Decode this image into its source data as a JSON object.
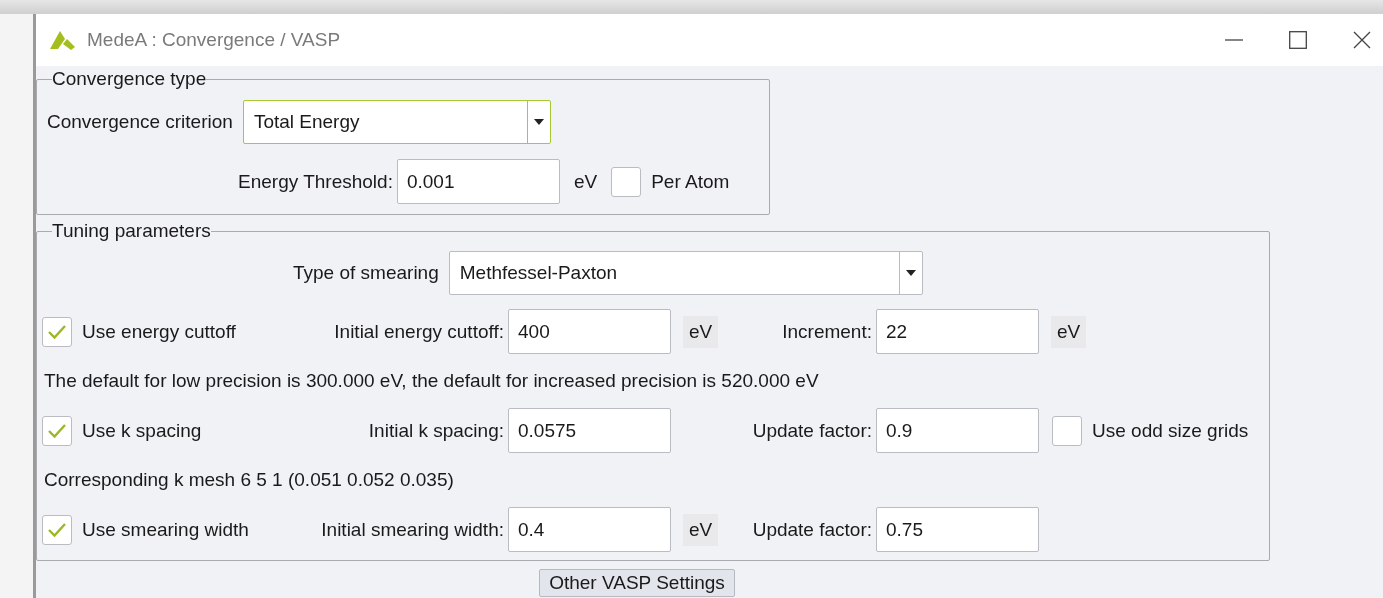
{
  "window": {
    "title": "MedeA : Convergence / VASP"
  },
  "convergence_type": {
    "title": "Convergence type",
    "criterion": {
      "label": "Convergence criterion",
      "value": "Total Energy",
      "focused": true
    },
    "threshold": {
      "label": "Energy Threshold:",
      "value": "0.001",
      "unit": "eV"
    },
    "per_atom": {
      "label": "Per Atom",
      "checked": false
    }
  },
  "tuning": {
    "title": "Tuning parameters",
    "smearing_type": {
      "label": "Type of smearing",
      "value": "Methfessel-Paxton",
      "focused": false
    },
    "rows": [
      {
        "kind": "params",
        "toggle": {
          "label": "Use energy cuttoff",
          "checked": true
        },
        "initial": {
          "label": "Initial energy cuttoff:",
          "value": "400",
          "unit": "eV"
        },
        "second": {
          "label": "Increment:",
          "value": "22",
          "unit": "eV"
        }
      },
      {
        "kind": "note",
        "text": "The default for low precision is 300.000 eV, the default for increased precision is 520.000 eV"
      },
      {
        "kind": "params",
        "toggle": {
          "label": "Use k spacing",
          "checked": true
        },
        "initial": {
          "label": "Initial k spacing:",
          "value": "0.0575"
        },
        "second": {
          "label": "Update factor:",
          "value": "0.9"
        },
        "option": {
          "label": "Use odd size grids",
          "checked": false
        }
      },
      {
        "kind": "note",
        "text": "Corresponding k mesh 6 5 1 (0.051 0.052 0.035)"
      },
      {
        "kind": "params",
        "toggle": {
          "label": "Use smearing width",
          "checked": true
        },
        "initial": {
          "label": "Initial smearing width:",
          "value": "0.4",
          "unit": "eV"
        },
        "second": {
          "label": "Update factor:",
          "value": "0.75"
        }
      }
    ]
  },
  "buttons": [
    {
      "label": "Other VASP Settings"
    }
  ]
}
